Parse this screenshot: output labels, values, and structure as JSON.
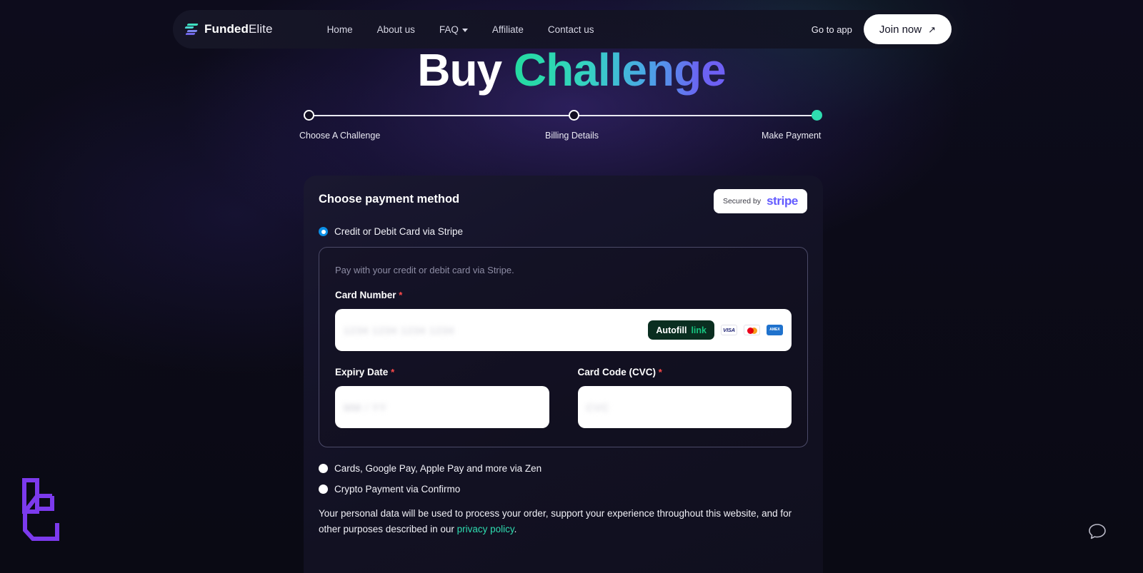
{
  "nav": {
    "brand_bold": "Funded",
    "brand_light": "Elite",
    "links": [
      {
        "label": "Home",
        "has_caret": false
      },
      {
        "label": "About us",
        "has_caret": false
      },
      {
        "label": "FAQ",
        "has_caret": true
      },
      {
        "label": "Affiliate",
        "has_caret": false
      },
      {
        "label": "Contact us",
        "has_caret": false
      }
    ],
    "go_to_app": "Go to app",
    "join_label": "Join now",
    "join_arrow": "↗"
  },
  "hero": {
    "title_white": "Buy",
    "title_gradient": "Challenge",
    "gradient_from": "#24dba0",
    "gradient_to": "#6f5ff5"
  },
  "stepper": {
    "steps": [
      {
        "label": "Choose A Challenge",
        "state": "upcoming"
      },
      {
        "label": "Billing Details",
        "state": "upcoming"
      },
      {
        "label": "Make Payment",
        "state": "active"
      }
    ],
    "active_color": "#2fdcb0"
  },
  "panel": {
    "title": "Choose payment method",
    "stripe_badge": {
      "secured_by": "Secured by",
      "brand": "stripe",
      "brand_color": "#635bff"
    },
    "methods": [
      {
        "label": "Credit or Debit Card via Stripe",
        "selected": true
      },
      {
        "label": "Cards, Google Pay, Apple Pay and more via Zen",
        "selected": false
      },
      {
        "label": "Crypto Payment via Confirmo",
        "selected": false
      }
    ],
    "stripe_form": {
      "note": "Pay with your credit or debit card via Stripe.",
      "card_number": {
        "label": "Card Number",
        "required_mark": "*",
        "placeholder": "1234 1234 1234 1234",
        "autofill": {
          "text": "Autofill",
          "link": "link"
        },
        "brands": [
          "visa",
          "mastercard",
          "amex"
        ],
        "visa_text": "VISA",
        "amex_text": "AMEX"
      },
      "expiry": {
        "label": "Expiry Date",
        "required_mark": "*",
        "placeholder": "MM / YY"
      },
      "cvc": {
        "label": "Card Code (CVC)",
        "required_mark": "*",
        "placeholder": "CVC"
      }
    },
    "consent_text_before": "Your personal data will be used to process your order, support your experience throughout this website, and for other purposes described in our ",
    "consent_link": "privacy policy",
    "consent_text_after": "."
  },
  "widgets": {
    "watermark_logo": "lc-monogram",
    "chat_button": "chat-bubble"
  }
}
